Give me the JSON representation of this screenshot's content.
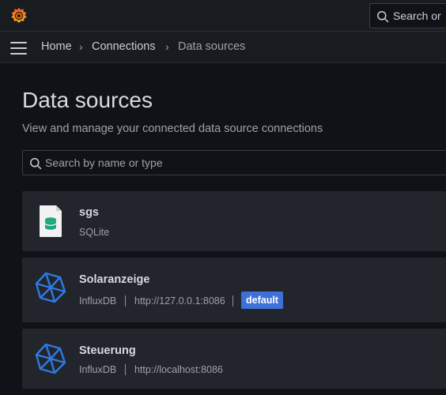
{
  "topbar": {
    "logo_icon": "grafana-logo-icon",
    "search_placeholder": "Search or"
  },
  "breadcrumb": {
    "items": [
      {
        "label": "Home"
      },
      {
        "label": "Connections"
      },
      {
        "label": "Data sources"
      }
    ],
    "separator": "›"
  },
  "page": {
    "title": "Data sources",
    "subtitle": "View and manage your connected data source connections"
  },
  "filter": {
    "placeholder": "Search by name or type",
    "value": ""
  },
  "datasources": [
    {
      "name": "sgs",
      "type": "SQLite",
      "url": "",
      "is_default": false,
      "icon": "sqlite-icon"
    },
    {
      "name": "Solaranzeige",
      "type": "InfluxDB",
      "url": "http://127.0.0.1:8086",
      "is_default": true,
      "default_label": "default",
      "icon": "influxdb-icon"
    },
    {
      "name": "Steuerung",
      "type": "InfluxDB",
      "url": "http://localhost:8086",
      "is_default": false,
      "icon": "influxdb-icon"
    }
  ],
  "colors": {
    "background": "#111217",
    "card": "#22252b",
    "badge": "#3d71d9",
    "logo_orange": "#f46800",
    "influx_blue": "#2e7ae5",
    "sqlite_green": "#1fa77a"
  }
}
